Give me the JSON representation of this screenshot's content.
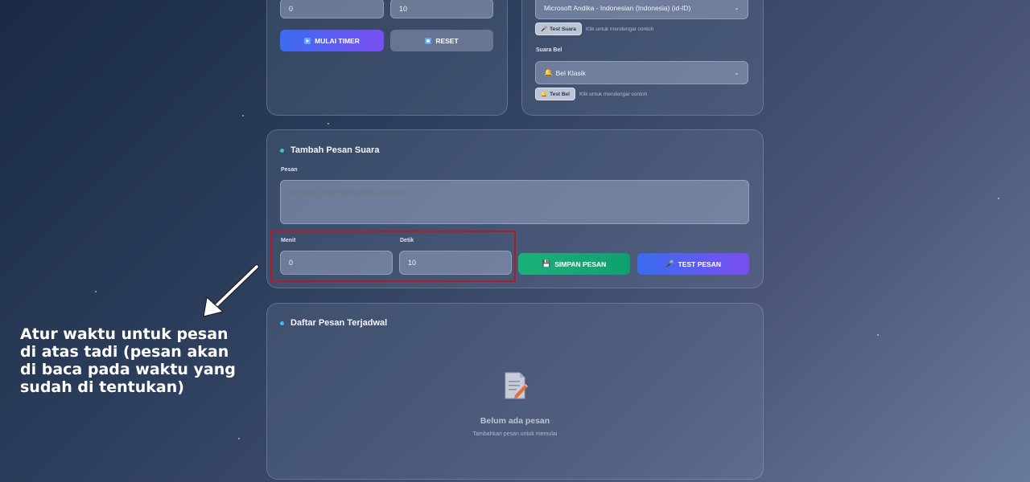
{
  "timer_card": {
    "minute_value": "0",
    "second_value": "10",
    "start_label": "MULAI TIMER",
    "reset_label": "RESET"
  },
  "voice_card": {
    "voice_select_value": "Microsoft Andika - Indonesian (Indonesia) (id-ID)",
    "test_voice_label": "Test Suara",
    "test_voice_hint": "Klik untuk mendengar contoh",
    "bell_label": "Suara Bel",
    "bell_select_value": "Bel Klasik",
    "test_bell_label": "Test Bel",
    "test_bell_hint": "Klik untuk mendengar contoh"
  },
  "add_message": {
    "title": "Tambah Pesan Suara",
    "message_label": "Pesan",
    "message_placeholder": "Masukkan pesan yang akan diucapkan...",
    "minute_label": "Menit",
    "minute_value": "0",
    "second_label": "Detik",
    "second_value": "10",
    "save_label": "SIMPAN PESAN",
    "test_label": "TEST PESAN"
  },
  "scheduled": {
    "title": "Daftar Pesan Terjadwal",
    "empty_title": "Belum ada pesan",
    "empty_subtitle": "Tambahkan pesan untuk memulai"
  },
  "annotation": {
    "text_line1": "Atur waktu untuk pesan",
    "text_line2": "di atas tadi (pesan akan",
    "text_line3": "di baca pada waktu yang",
    "text_line4": "sudah di tentukan)"
  },
  "colors": {
    "accent_gradient_start": "#3b6cf0",
    "accent_gradient_end": "#7a4ef0",
    "save_green": "#1bb07a",
    "highlight_red": "#b01c2c"
  }
}
